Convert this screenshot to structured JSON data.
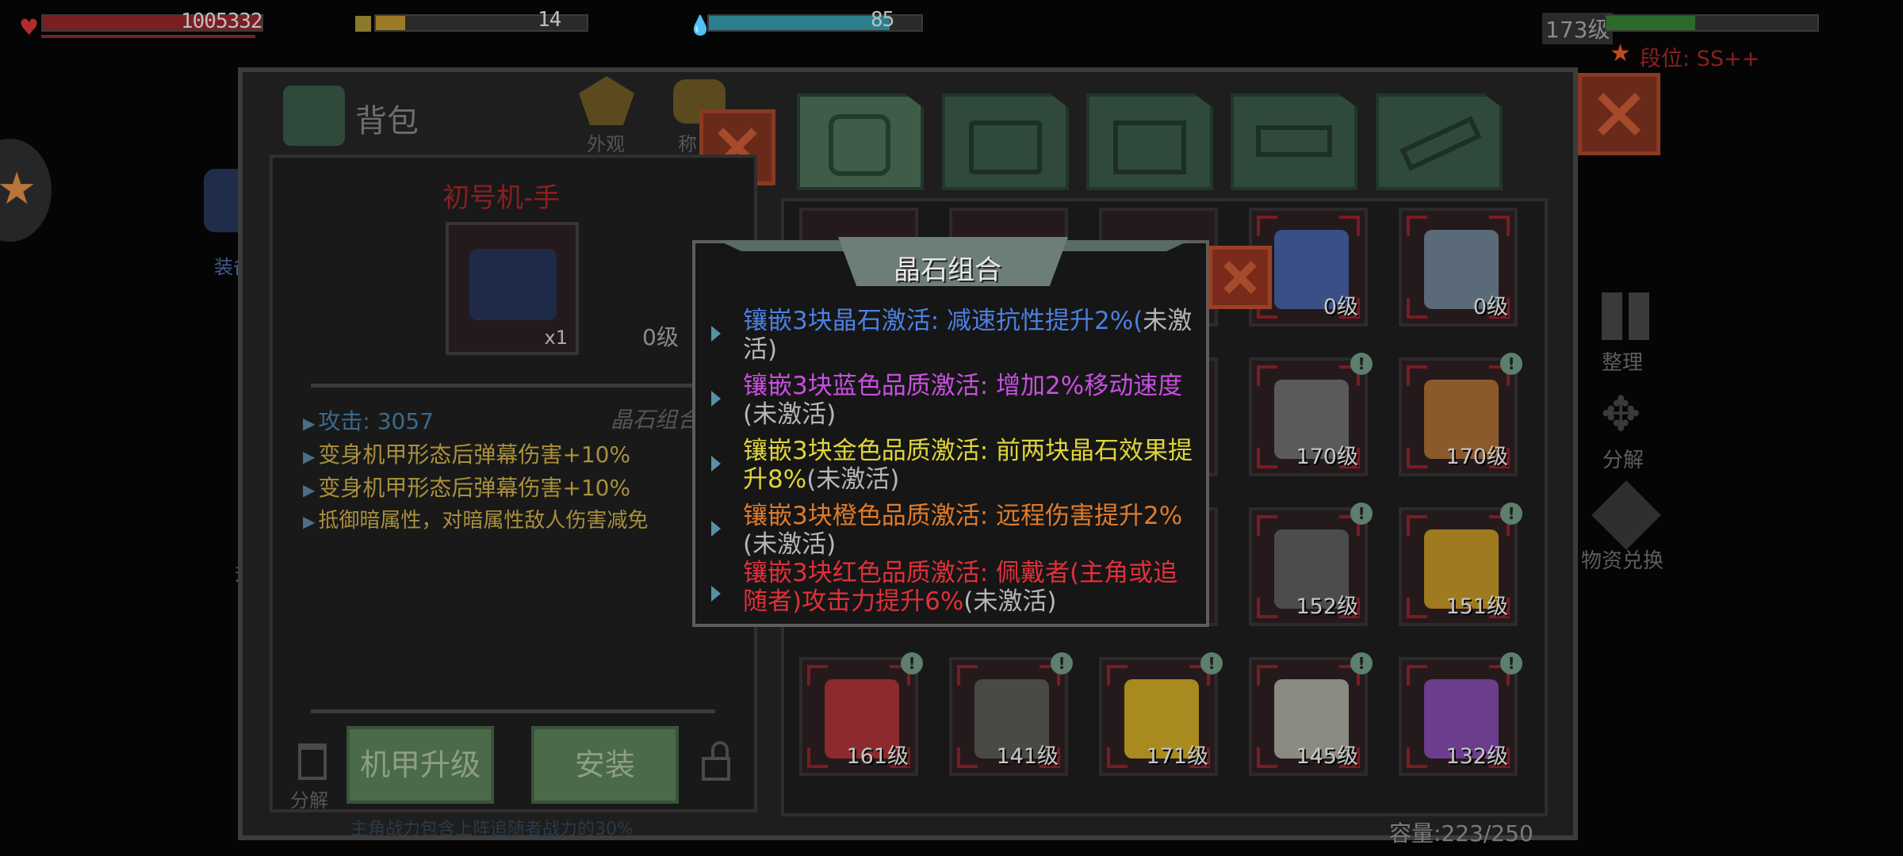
{
  "hud": {
    "health": "1005332",
    "energy": "14",
    "water": "85",
    "player_level": "173级",
    "rank": "段位: SS++"
  },
  "panel": {
    "title": "背包",
    "tab_appearance": "外观",
    "tab_partial": "称",
    "item_name": "初号机-手",
    "item_count": "x1",
    "item_level": "0级",
    "attributes": [
      "攻击: 3057",
      "变身机甲形态后弹幕伤害+10%",
      "变身机甲形态后弹幕伤害+10%",
      "抵御暗属性，对暗属性敌人伤害减免"
    ],
    "gem_combo_label": "晶石组合",
    "btn_upgrade": "机甲升级",
    "btn_install": "安装",
    "decompose_label": "分解",
    "footer_text": "主角战力包含上阵追随者战力的30%",
    "capacity": "容量:223/250"
  },
  "left_side": {
    "equip": "装备",
    "upgrade_partial": "升"
  },
  "right_side": {
    "sort": "整理",
    "decompose": "分解",
    "exchange": "物资兑换"
  },
  "grid": {
    "items": [
      {
        "level": "0级",
        "color": "#3a4f86",
        "badge": false
      },
      {
        "level": "0级",
        "color": "#5b6a78",
        "badge": false
      },
      {
        "level": "170级",
        "color": "#5a5a5a",
        "badge": true
      },
      {
        "level": "170级",
        "color": "#8b5a2b",
        "badge": true
      },
      {
        "level": "152级",
        "color": "#4c4c4c",
        "badge": true
      },
      {
        "level": "151级",
        "color": "#a07a1e",
        "badge": true
      },
      {
        "level": "161级",
        "color": "#8c2a2e",
        "badge": true
      },
      {
        "level": "141级",
        "color": "#4a4a45",
        "badge": true
      },
      {
        "level": "171级",
        "color": "#a88a1e",
        "badge": true
      },
      {
        "level": "145级",
        "color": "#8a8a80",
        "badge": true
      },
      {
        "level": "132级",
        "color": "#6b3d8c",
        "badge": true
      }
    ]
  },
  "popup": {
    "title": "晶石组合",
    "lines": [
      {
        "text": "镶嵌3块晶石激活: 减速抗性提升2%(",
        "rest": "未激活)",
        "color": "#4d7fe0"
      },
      {
        "text": "镶嵌3块蓝色品质激活: 增加2%移动速度",
        "rest": "(未激活)",
        "color": "#c84fe0"
      },
      {
        "text": "镶嵌3块金色品质激活: 前两块晶石效果提升8%",
        "rest": "(未激活)",
        "color": "#e0d43a"
      },
      {
        "text": "镶嵌3块橙色品质激活: 远程伤害提升2%",
        "rest": "(未激活)",
        "color": "#e07a2a"
      },
      {
        "text": "镶嵌3块红色品质激活: 佩戴者(主角或追随者)攻击力提升6%",
        "rest": "(未激活)",
        "color": "#e0303a"
      }
    ]
  }
}
